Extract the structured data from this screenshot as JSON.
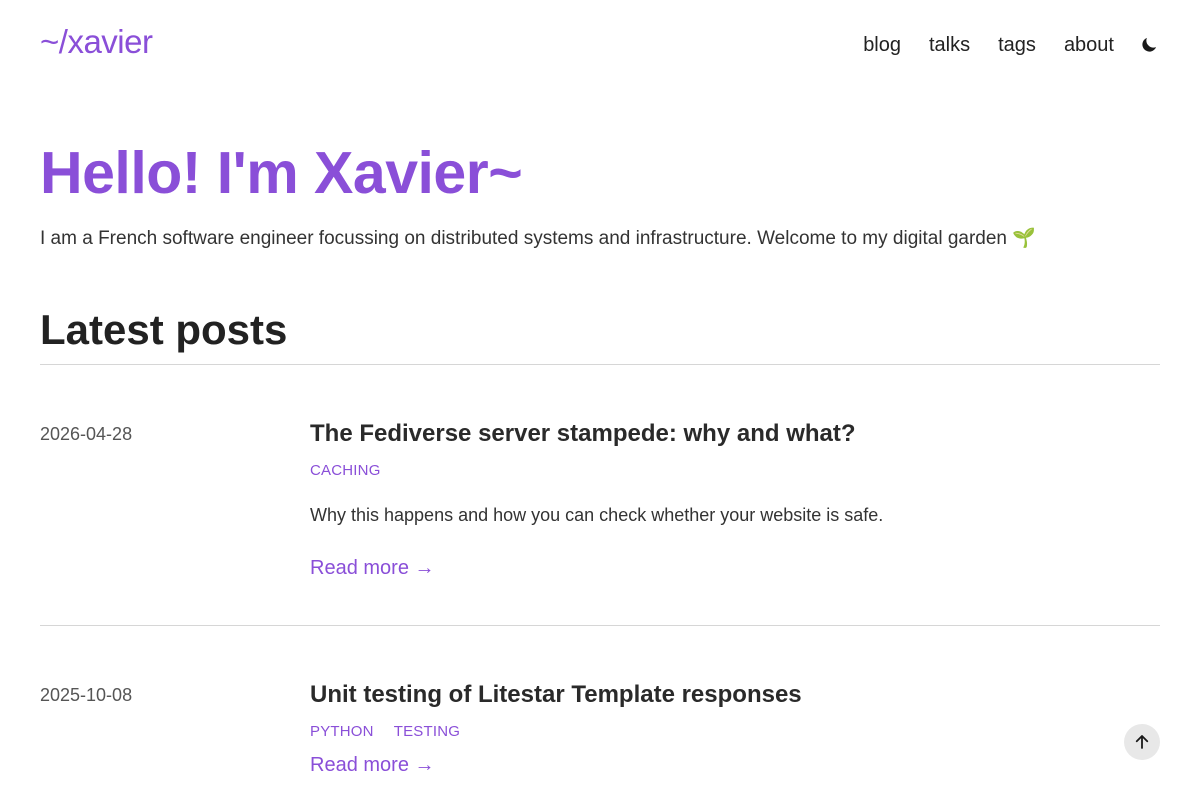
{
  "header": {
    "logo": "~/xavier",
    "nav": [
      {
        "label": "blog"
      },
      {
        "label": "talks"
      },
      {
        "label": "tags"
      },
      {
        "label": "about"
      }
    ],
    "theme_toggle_icon": "moon-icon"
  },
  "hero": {
    "title": "Hello! I'm Xavier~",
    "intro": "I am a French software engineer focussing on distributed systems and infrastructure. Welcome to my digital garden 🌱"
  },
  "latest_posts": {
    "title": "Latest posts",
    "posts": [
      {
        "date": "2026-04-28",
        "title": "The Fediverse server stampede: why and what?",
        "tags": [
          "CACHING"
        ],
        "summary": "Why this happens and how you can check whether your website is safe.",
        "read_more": "Read more →"
      },
      {
        "date": "2025-10-08",
        "title": "Unit testing of Litestar Template responses",
        "tags": [
          "PYTHON",
          "TESTING"
        ],
        "read_more": "Read more →"
      }
    ]
  },
  "back_to_top_icon": "arrow-up-icon",
  "colors": {
    "accent": "#8a4fd8",
    "text": "#222222",
    "rule": "#d6d6d6"
  }
}
